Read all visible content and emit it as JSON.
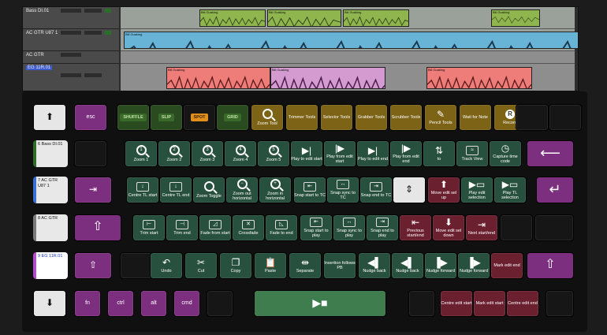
{
  "colors": {
    "green": "#28503e",
    "gold": "#7c6316",
    "red": "#6b2030",
    "purple": "#7d2f7f",
    "spot": "#c47a12",
    "clip_audio": "#68b4d6",
    "clip_red": "#ee7c78",
    "clip_green": "#8fb54e"
  },
  "daw": {
    "tracks": [
      {
        "name": "Bass DI.01",
        "selected": false
      },
      {
        "name": "AC GTR U87 1",
        "selected": false
      },
      {
        "name": "AC GTR",
        "selected": false
      },
      {
        "name": "EG 11R.01",
        "selected": true
      }
    ],
    "clip_labels": {
      "bass": "Bill Guaking",
      "acgtr": "Bill Guaking",
      "eg": "Bill Guaking"
    }
  },
  "keys": {
    "row0": {
      "up": "up-arrow-icon",
      "esc": "esc",
      "shuffle": "SHUFFLE",
      "slip": "SLIP",
      "spot": "SPOT",
      "grid": "GRID",
      "zoom_tool": "Zoom Tool",
      "trimmer": "Trimmer Tools",
      "selector": "Selector Tools",
      "grabber": "Grabber Tools",
      "scrubber": "Scrubber Tools",
      "pencil": "Pencil Tools",
      "wait": "Wait for Note",
      "record": "Record",
      "record_glyph": "R"
    },
    "row1": {
      "track": "6 Bass DI.01",
      "zoom1": "Zoom 1",
      "zoom2": "Zoom 2",
      "zoom3": "Zoom 3",
      "zoom4": "Zoom 4",
      "zoom5": "Zoom 5",
      "play_to_edit_start": "Play to edit start",
      "play_from_edit_start": "Play from edit start",
      "play_to_edit_end": "Play to edit end",
      "play_from_edit_end": "Play from edit end",
      "to": "to",
      "track_view": "Track View",
      "capture": "Capture time code"
    },
    "row2": {
      "track": "7 AC GTR U87 1",
      "centre_tl_start": "Centre TL start",
      "centre_tl_end": "Centre TL end",
      "zoom_toggle": "Zoom Toggle",
      "zoom_out_h": "Zoom out horizontal",
      "zoom_in_h": "Zoom in horizontal",
      "snap_start_tc": "Snap start to TC",
      "snap_sync_tc": "Snap sync to TC",
      "snap_end_tc": "Snap end to TC",
      "move_up": "Move edit sel up",
      "play_edit_sel": "Play edit selection",
      "play_tl_sel": "Play TL selection"
    },
    "row3": {
      "track": "8 AC GTR",
      "trim_start": "Trim start",
      "trim_end": "Trim end",
      "fade_from_start": "Fade from start",
      "crossfade": "Crossfade",
      "fade_to_end": "Fade to end",
      "snap_start_play": "Snap start to play",
      "snap_sync_play": "Snap sync to play",
      "snap_end_play": "Snap end to play",
      "prev": "Previous start/end",
      "move_down": "Move edit sel down",
      "next": "Next start/end"
    },
    "row4": {
      "track": "9 EG 11R.01",
      "undo": "Undo",
      "cut": "Cut",
      "copy": "Copy",
      "paste": "Paste",
      "separate": "Separate",
      "insertion": "Insertion follows PB",
      "nudge_back1": "Nudge back",
      "nudge_back2": "Nudge back",
      "nudge_fwd1": "Nudge forward",
      "nudge_fwd2": "Nudge forward",
      "mark_edit_end": "Mark edit end"
    },
    "row5": {
      "fn": "fn",
      "ctrl": "ctrl",
      "alt": "alt",
      "cmd": "cmd",
      "play_stop": "play-stop-icon",
      "centre_edit_start": "Centre edit start",
      "mark_edit_start": "Mark edit start",
      "centre_edit_end": "Centre edit end"
    }
  }
}
